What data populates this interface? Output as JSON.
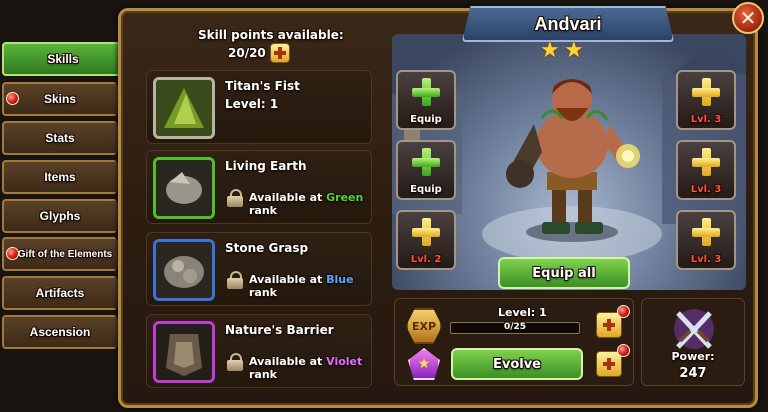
{
  "tabs": [
    {
      "label": "Skills",
      "active": true,
      "notification": false
    },
    {
      "label": "Skins",
      "active": false,
      "notification": true
    },
    {
      "label": "Stats",
      "active": false,
      "notification": false
    },
    {
      "label": "Items",
      "active": false,
      "notification": false
    },
    {
      "label": "Glyphs",
      "active": false,
      "notification": false
    },
    {
      "label": "Gift of the Elements",
      "active": false,
      "notification": true
    },
    {
      "label": "Artifacts",
      "active": false,
      "notification": false
    },
    {
      "label": "Ascension",
      "active": false,
      "notification": false
    }
  ],
  "skill_points": {
    "title": "Skill points available:",
    "value": "20/20"
  },
  "skills": [
    {
      "name": "Titan's Fist",
      "detail": "Level: 1",
      "locked": false,
      "frame_color": "#b9b2a6"
    },
    {
      "name": "Living Earth",
      "prefix": "Available at ",
      "rank": "Green",
      "suffix": " rank",
      "locked": true,
      "frame_color": "#4fc02a",
      "rank_color": "#52d13a"
    },
    {
      "name": "Stone Grasp",
      "prefix": "Available at ",
      "rank": "Blue",
      "suffix": " rank",
      "locked": true,
      "frame_color": "#3d72d8",
      "rank_color": "#58a4ff"
    },
    {
      "name": "Nature's Barrier",
      "prefix": "Available at ",
      "rank": "Violet",
      "suffix": " rank",
      "locked": true,
      "frame_color": "#c23ad8",
      "rank_color": "#e26cff"
    }
  ],
  "hero": {
    "name": "Andvari",
    "stars": 2
  },
  "equipment": {
    "left": [
      {
        "type": "green",
        "caption": "Equip"
      },
      {
        "type": "green",
        "caption": "Equip"
      },
      {
        "type": "yellow",
        "caption": "Lvl. 2"
      }
    ],
    "right": [
      {
        "type": "yellow",
        "caption": "Lvl. 3"
      },
      {
        "type": "yellow",
        "caption": "Lvl. 3"
      },
      {
        "type": "yellow",
        "caption": "Lvl. 3"
      }
    ]
  },
  "buttons": {
    "equip_all": "Equip all",
    "evolve": "Evolve",
    "close": "✕"
  },
  "level": {
    "exp_badge": "EXP",
    "label": "Level: 1",
    "progress_text": "0/25",
    "progress": 0
  },
  "power": {
    "label": "Power:",
    "value": "247"
  }
}
